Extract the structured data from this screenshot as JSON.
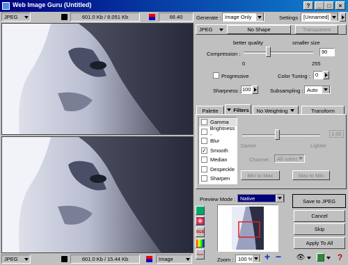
{
  "window": {
    "title": "Web Image Guru (Untitled)"
  },
  "top_status": {
    "format": "JPEG",
    "size": "601.0 Kb / 8.051 Kb",
    "zoom": "66.40"
  },
  "bottom_status": {
    "format": "JPEG",
    "size": "601.0 Kb / 15.44 Kb",
    "view": "Image"
  },
  "generate": {
    "label": "Generate :",
    "value": "Image Only"
  },
  "settings": {
    "label": "Settings :",
    "value": "[Unnamed]"
  },
  "format_bar": {
    "format": "JPEG",
    "shape": "No Shape",
    "button": "Transparent"
  },
  "compression": {
    "label": "Compression :",
    "better": "better quality",
    "smaller": "smaller size",
    "value": "90",
    "min": "0",
    "max": "255",
    "level": 0.35
  },
  "progressive": {
    "label": "Progressive",
    "checked": false
  },
  "color_tuning": {
    "label": "Color Tuning :",
    "value": "0"
  },
  "sharpness": {
    "label": "Sharpness :",
    "value": "100"
  },
  "subsampling": {
    "label": "Subsampling :",
    "value": "Auto"
  },
  "tabs": [
    "Palette",
    "Filters",
    "No Weighting",
    "Transform"
  ],
  "filters": [
    {
      "label": "Gamma",
      "checked": false
    },
    {
      "label": "Brightness -",
      "checked": false
    },
    {
      "label": "Blur",
      "checked": false
    },
    {
      "label": "Smooth",
      "checked": true
    },
    {
      "label": "Median",
      "checked": false
    },
    {
      "label": "Despeckle",
      "checked": false
    },
    {
      "label": "Sharpen",
      "checked": false
    }
  ],
  "filter_panel": {
    "value": "1.00",
    "darker": "Darker",
    "lighter": "Lighter",
    "channel_label": "Channel :",
    "channel_value": "All colors",
    "btn_max": "Min to Max",
    "btn_apply": "Max to Min",
    "level": 0.45
  },
  "preview_mode": {
    "label": "Preview Mode :",
    "value": "Native"
  },
  "zoom": {
    "label": "Zoom :",
    "value": "100 %"
  },
  "actions": {
    "save": "Save to JPEG",
    "cancel": "Cancel",
    "skip": "Skip",
    "apply_all": "Apply To All"
  },
  "tool_labels": {
    "rgb": "RGB",
    "mask": "Mask"
  }
}
